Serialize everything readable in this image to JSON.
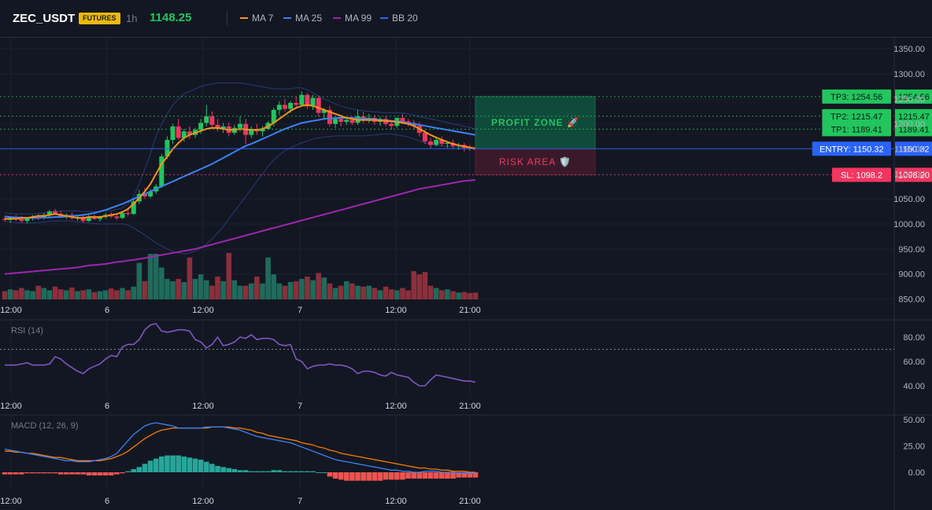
{
  "header": {
    "symbol": "ZEC_USDT",
    "badge": "FUTURES",
    "timeframe": "1h",
    "price": "1148.25",
    "indicators": [
      {
        "label": "MA 7",
        "color": "#f7931a"
      },
      {
        "label": "MA 25",
        "color": "#3b82f6"
      },
      {
        "label": "MA 99",
        "color": "#9c27b0"
      },
      {
        "label": "BB 20",
        "color": "#2962ff"
      }
    ]
  },
  "colors": {
    "bull": "#22c55e",
    "bear": "#f23660",
    "vol_bull": "#1f6b5b",
    "vol_bear": "#8c2f3c",
    "ma7": "#f7931a",
    "ma25": "#3b82f6",
    "ma99": "#9c27b0",
    "bb": "#2962ff",
    "rsi": "#7e57c2",
    "macd": "#3b82f6",
    "signal": "#f57c00",
    "hist_pos": "#26a69a",
    "hist_neg": "#ef5350"
  },
  "price_axis": {
    "ticks": [
      "1350.00",
      "1300.00",
      "1250.00",
      "1200.00",
      "1150.00",
      "1100.00",
      "1050.00",
      "1000.00",
      "950.00",
      "900.00",
      "850.00"
    ]
  },
  "time_axis": {
    "ticks": [
      "12:00",
      "6",
      "12:00",
      "7",
      "12:00",
      "21:00"
    ]
  },
  "levels": [
    {
      "label": "TP3: 1254.56",
      "value": "1254.56",
      "price": 1254.56,
      "kind": "tp"
    },
    {
      "label": "TP2: 1215.47",
      "value": "1215.47",
      "price": 1215.47,
      "kind": "tp"
    },
    {
      "label": "TP1: 1189.41",
      "value": "1189.41",
      "price": 1189.41,
      "kind": "tp"
    },
    {
      "label": "ENTRY: 1150.32",
      "value": "1150.32",
      "price": 1150.32,
      "kind": "entry"
    },
    {
      "label": "SL: 1098.2",
      "value": "1098.20",
      "price": 1098.2,
      "kind": "sl"
    }
  ],
  "zones": {
    "profit": "PROFIT ZONE 🚀",
    "risk": "RISK AREA 🛡️"
  },
  "rsi": {
    "label": "RSI (14)",
    "ticks": [
      "80.00",
      "60.00",
      "40.00"
    ]
  },
  "macd": {
    "label": "MACD (12, 26, 9)",
    "ticks": [
      "50.00",
      "25.00",
      "0.00"
    ]
  },
  "chart_data": {
    "type": "candlestick",
    "ohlc": [
      [
        1010,
        1015,
        1005,
        1008
      ],
      [
        1008,
        1014,
        1002,
        1012
      ],
      [
        1012,
        1018,
        1006,
        1010
      ],
      [
        1010,
        1015,
        1003,
        1006
      ],
      [
        1006,
        1013,
        1001,
        1011
      ],
      [
        1011,
        1018,
        1007,
        1015
      ],
      [
        1015,
        1020,
        1008,
        1012
      ],
      [
        1012,
        1022,
        1009,
        1018
      ],
      [
        1018,
        1028,
        1014,
        1025
      ],
      [
        1025,
        1030,
        1018,
        1020
      ],
      [
        1020,
        1026,
        1012,
        1015
      ],
      [
        1015,
        1021,
        1010,
        1018
      ],
      [
        1018,
        1023,
        1008,
        1012
      ],
      [
        1012,
        1017,
        1006,
        1014
      ],
      [
        1014,
        1020,
        1002,
        1006
      ],
      [
        1006,
        1018,
        1004,
        1015
      ],
      [
        1015,
        1019,
        1008,
        1010
      ],
      [
        1010,
        1016,
        1005,
        1014
      ],
      [
        1014,
        1022,
        1010,
        1018
      ],
      [
        1018,
        1024,
        1012,
        1015
      ],
      [
        1015,
        1020,
        1008,
        1012
      ],
      [
        1012,
        1026,
        1010,
        1022
      ],
      [
        1022,
        1030,
        1015,
        1020
      ],
      [
        1020,
        1050,
        1018,
        1045
      ],
      [
        1045,
        1068,
        1040,
        1060
      ],
      [
        1060,
        1072,
        1050,
        1055
      ],
      [
        1055,
        1070,
        1052,
        1065
      ],
      [
        1065,
        1080,
        1060,
        1075
      ],
      [
        1075,
        1140,
        1072,
        1135
      ],
      [
        1135,
        1175,
        1130,
        1168
      ],
      [
        1168,
        1200,
        1160,
        1195
      ],
      [
        1195,
        1210,
        1168,
        1172
      ],
      [
        1172,
        1190,
        1165,
        1185
      ],
      [
        1185,
        1195,
        1170,
        1178
      ],
      [
        1178,
        1192,
        1172,
        1188
      ],
      [
        1188,
        1210,
        1180,
        1202
      ],
      [
        1202,
        1238,
        1195,
        1215
      ],
      [
        1215,
        1225,
        1192,
        1198
      ],
      [
        1198,
        1210,
        1185,
        1190
      ],
      [
        1190,
        1202,
        1182,
        1195
      ],
      [
        1195,
        1203,
        1175,
        1182
      ],
      [
        1182,
        1198,
        1178,
        1192
      ],
      [
        1192,
        1215,
        1185,
        1200
      ],
      [
        1200,
        1210,
        1160,
        1178
      ],
      [
        1178,
        1195,
        1172,
        1190
      ],
      [
        1190,
        1200,
        1178,
        1185
      ],
      [
        1185,
        1196,
        1175,
        1190
      ],
      [
        1190,
        1206,
        1188,
        1202
      ],
      [
        1202,
        1232,
        1195,
        1228
      ],
      [
        1228,
        1245,
        1218,
        1238
      ],
      [
        1238,
        1250,
        1225,
        1230
      ],
      [
        1230,
        1246,
        1222,
        1242
      ],
      [
        1242,
        1255,
        1232,
        1238
      ],
      [
        1238,
        1265,
        1235,
        1258
      ],
      [
        1258,
        1262,
        1230,
        1235
      ],
      [
        1235,
        1258,
        1228,
        1252
      ],
      [
        1252,
        1256,
        1215,
        1222
      ],
      [
        1222,
        1232,
        1208,
        1228
      ],
      [
        1228,
        1236,
        1195,
        1200
      ],
      [
        1200,
        1214,
        1192,
        1210
      ],
      [
        1210,
        1216,
        1195,
        1204
      ],
      [
        1204,
        1212,
        1198,
        1208
      ],
      [
        1208,
        1215,
        1198,
        1202
      ],
      [
        1202,
        1228,
        1198,
        1215
      ],
      [
        1215,
        1224,
        1202,
        1206
      ],
      [
        1206,
        1220,
        1202,
        1212
      ],
      [
        1212,
        1218,
        1198,
        1204
      ],
      [
        1204,
        1214,
        1196,
        1210
      ],
      [
        1210,
        1216,
        1195,
        1200
      ],
      [
        1200,
        1206,
        1188,
        1196
      ],
      [
        1196,
        1213,
        1192,
        1212
      ],
      [
        1212,
        1220,
        1200,
        1205
      ],
      [
        1205,
        1210,
        1195,
        1202
      ],
      [
        1202,
        1208,
        1190,
        1196
      ],
      [
        1196,
        1204,
        1175,
        1182
      ],
      [
        1182,
        1188,
        1160,
        1165
      ],
      [
        1165,
        1172,
        1150,
        1158
      ],
      [
        1158,
        1172,
        1155,
        1168
      ],
      [
        1168,
        1175,
        1155,
        1160
      ],
      [
        1160,
        1166,
        1152,
        1162
      ],
      [
        1162,
        1168,
        1150,
        1156
      ],
      [
        1156,
        1162,
        1148,
        1158
      ],
      [
        1158,
        1162,
        1145,
        1152
      ],
      [
        1152,
        1158,
        1146,
        1150
      ],
      [
        1150,
        1156,
        1144,
        1148
      ]
    ],
    "volume": [
      0.18,
      0.22,
      0.2,
      0.25,
      0.2,
      0.18,
      0.3,
      0.25,
      0.2,
      0.28,
      0.22,
      0.2,
      0.26,
      0.18,
      0.2,
      0.22,
      0.16,
      0.18,
      0.2,
      0.24,
      0.2,
      0.25,
      0.2,
      0.28,
      0.8,
      0.4,
      1.0,
      1.0,
      0.7,
      0.45,
      0.4,
      0.45,
      0.38,
      0.92,
      0.45,
      0.55,
      0.42,
      0.3,
      0.5,
      0.4,
      1.02,
      0.42,
      0.3,
      0.3,
      0.35,
      0.5,
      0.35,
      0.92,
      0.55,
      0.35,
      0.3,
      0.38,
      0.4,
      0.45,
      0.5,
      0.42,
      0.58,
      0.48,
      0.35,
      0.25,
      0.3,
      0.4,
      0.35,
      0.3,
      0.28,
      0.3,
      0.25,
      0.2,
      0.28,
      0.22,
      0.2,
      0.25,
      0.2,
      0.62,
      0.55,
      0.6,
      0.3,
      0.25,
      0.2,
      0.22,
      0.18,
      0.15,
      0.16,
      0.14,
      0.15
    ],
    "ma7": [
      1010,
      1011,
      1010,
      1012,
      1012,
      1014,
      1016,
      1016,
      1018,
      1020,
      1018,
      1016,
      1014,
      1012,
      1012,
      1014,
      1014,
      1014,
      1016,
      1018,
      1020,
      1024,
      1030,
      1040,
      1052,
      1065,
      1080,
      1100,
      1120,
      1135,
      1150,
      1162,
      1172,
      1178,
      1182,
      1186,
      1190,
      1192,
      1192,
      1190,
      1188,
      1188,
      1190,
      1189,
      1188,
      1188,
      1190,
      1195,
      1202,
      1210,
      1218,
      1226,
      1232,
      1236,
      1238,
      1236,
      1232,
      1228,
      1224,
      1220,
      1216,
      1212,
      1210,
      1208,
      1208,
      1208,
      1208,
      1207,
      1206,
      1205,
      1204,
      1202,
      1200,
      1196,
      1190,
      1184,
      1178,
      1173,
      1168,
      1164,
      1160,
      1157,
      1155,
      1153,
      1151
    ],
    "ma25": [
      1015,
      1014,
      1013,
      1013,
      1012,
      1012,
      1012,
      1013,
      1013,
      1014,
      1014,
      1015,
      1016,
      1017,
      1018,
      1020,
      1022,
      1025,
      1028,
      1032,
      1036,
      1040,
      1045,
      1050,
      1055,
      1060,
      1065,
      1070,
      1075,
      1080,
      1085,
      1090,
      1095,
      1100,
      1105,
      1110,
      1115,
      1120,
      1126,
      1132,
      1138,
      1144,
      1150,
      1156,
      1160,
      1165,
      1170,
      1175,
      1180,
      1185,
      1190,
      1194,
      1198,
      1202,
      1204,
      1206,
      1208,
      1210,
      1211,
      1212,
      1212,
      1212,
      1212,
      1211,
      1211,
      1210,
      1209,
      1208,
      1207,
      1206,
      1205,
      1204,
      1202,
      1200,
      1198,
      1196,
      1194,
      1192,
      1190,
      1188,
      1186,
      1184,
      1182,
      1180,
      1178
    ],
    "ma99": [
      900,
      901,
      902,
      903,
      904,
      905,
      906,
      907,
      908,
      909,
      910,
      911,
      912,
      913,
      915,
      917,
      918,
      919,
      920,
      922,
      924,
      925,
      927,
      928,
      930,
      932,
      934,
      936,
      938,
      940,
      942,
      944,
      946,
      948,
      950,
      953,
      956,
      959,
      962,
      965,
      968,
      971,
      974,
      977,
      980,
      983,
      986,
      989,
      992,
      995,
      998,
      1001,
      1004,
      1007,
      1010,
      1013,
      1016,
      1019,
      1022,
      1025,
      1028,
      1031,
      1034,
      1037,
      1040,
      1043,
      1046,
      1049,
      1052,
      1055,
      1058,
      1061,
      1064,
      1067,
      1070,
      1072,
      1074,
      1076,
      1078,
      1080,
      1082,
      1084,
      1086,
      1087,
      1088
    ],
    "bb_upper": [
      1022,
      1021,
      1020,
      1020,
      1020,
      1020,
      1021,
      1022,
      1024,
      1026,
      1026,
      1026,
      1026,
      1026,
      1025,
      1025,
      1025,
      1025,
      1026,
      1027,
      1029,
      1032,
      1040,
      1055,
      1080,
      1110,
      1140,
      1175,
      1200,
      1220,
      1238,
      1250,
      1260,
      1265,
      1270,
      1275,
      1278,
      1280,
      1282,
      1282,
      1282,
      1282,
      1282,
      1280,
      1278,
      1276,
      1274,
      1272,
      1270,
      1270,
      1270,
      1270,
      1272,
      1272,
      1268,
      1262,
      1256,
      1250,
      1245,
      1240,
      1236,
      1232,
      1230,
      1228,
      1226,
      1225,
      1224,
      1223,
      1222,
      1222,
      1222,
      1222,
      1220,
      1218,
      1215,
      1212,
      1210,
      1208,
      1205,
      1203,
      1200,
      1198,
      1195,
      1193,
      1190
    ],
    "bb_lower": [
      1005,
      1004,
      1003,
      1002,
      1002,
      1002,
      1003,
      1004,
      1005,
      1006,
      1006,
      1006,
      1005,
      1004,
      1003,
      1002,
      1001,
      1000,
      1000,
      1000,
      1000,
      1000,
      998,
      992,
      985,
      978,
      970,
      962,
      956,
      950,
      945,
      942,
      940,
      942,
      946,
      952,
      960,
      970,
      982,
      995,
      1010,
      1025,
      1040,
      1055,
      1070,
      1085,
      1100,
      1115,
      1128,
      1138,
      1146,
      1152,
      1158,
      1162,
      1166,
      1170,
      1172,
      1174,
      1175,
      1176,
      1176,
      1176,
      1176,
      1176,
      1176,
      1177,
      1178,
      1179,
      1180,
      1180,
      1178,
      1176,
      1174,
      1170,
      1166,
      1162,
      1160,
      1158,
      1156,
      1155,
      1154,
      1153,
      1152,
      1151,
      1150
    ],
    "rsi": [
      57,
      57,
      57,
      58,
      59,
      57,
      57,
      57,
      58,
      64,
      62,
      58,
      55,
      52,
      50,
      54,
      56,
      58,
      62,
      65,
      64,
      72,
      74,
      74,
      78,
      86,
      90,
      91,
      85,
      84,
      85,
      86,
      86,
      85,
      78,
      76,
      71,
      74,
      80,
      73,
      74,
      76,
      80,
      79,
      82,
      78,
      79,
      79,
      78,
      74,
      73,
      74,
      62,
      60,
      54,
      56,
      57,
      57,
      58,
      57,
      57,
      56,
      54,
      50,
      52,
      52,
      51,
      49,
      48,
      51,
      49,
      48,
      47,
      43,
      40,
      40,
      45,
      49,
      48,
      47,
      46,
      45,
      44,
      44,
      43
    ],
    "macd": [
      22,
      21,
      20,
      19,
      18,
      17,
      16,
      15,
      14,
      13,
      12,
      11,
      11,
      10,
      10,
      10,
      11,
      12,
      13,
      15,
      18,
      24,
      30,
      36,
      40,
      44,
      46,
      47,
      46,
      45,
      44,
      42,
      42,
      42,
      42,
      42,
      43,
      43,
      43,
      43,
      42,
      41,
      40,
      38,
      36,
      34,
      33,
      32,
      31,
      30,
      29,
      28,
      26,
      24,
      22,
      20,
      18,
      16,
      14,
      12,
      11,
      10,
      9,
      8,
      7,
      6,
      5,
      4,
      3,
      2,
      2,
      1,
      1,
      0,
      0,
      1,
      1,
      1,
      0,
      0,
      0,
      -1,
      -1,
      -1,
      -1
    ],
    "signal": [
      20,
      20,
      19,
      19,
      18,
      18,
      17,
      16,
      15,
      14,
      14,
      13,
      12,
      11,
      11,
      11,
      11,
      11,
      12,
      13,
      15,
      17,
      20,
      24,
      28,
      32,
      35,
      38,
      40,
      41,
      42,
      42,
      42,
      42,
      42,
      42,
      42,
      43,
      43,
      43,
      43,
      42,
      42,
      41,
      40,
      38,
      37,
      35,
      34,
      33,
      32,
      31,
      30,
      28,
      27,
      26,
      24,
      23,
      21,
      20,
      18,
      17,
      16,
      15,
      14,
      13,
      12,
      11,
      10,
      9,
      8,
      7,
      6,
      5,
      4,
      4,
      3,
      3,
      2,
      2,
      1,
      1,
      1,
      0,
      0
    ],
    "hist": [
      -2,
      -2,
      -2,
      -2,
      -1,
      -1,
      -1,
      -1,
      -1,
      -1,
      -2,
      -2,
      -2,
      -2,
      -2,
      -3,
      -3,
      -3,
      -3,
      -3,
      -2,
      -1,
      1,
      3,
      5,
      8,
      11,
      13,
      15,
      16,
      16,
      16,
      15,
      14,
      13,
      12,
      10,
      8,
      6,
      5,
      4,
      3,
      2,
      2,
      1,
      1,
      1,
      1,
      2,
      2,
      1,
      1,
      1,
      1,
      1,
      1,
      0,
      0,
      -4,
      -6,
      -7,
      -8,
      -8,
      -8,
      -8,
      -8,
      -8,
      -8,
      -7,
      -7,
      -7,
      -7,
      -6,
      -6,
      -6,
      -6,
      -6,
      -6,
      -6,
      -6,
      -6,
      -5,
      -5,
      -5,
      -5
    ]
  }
}
